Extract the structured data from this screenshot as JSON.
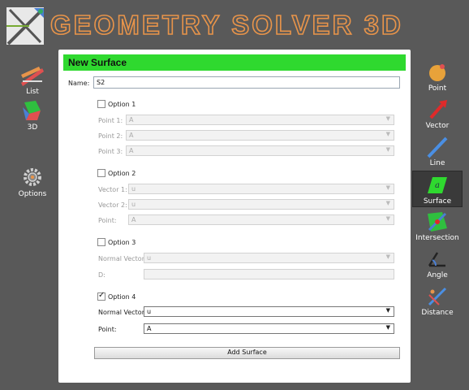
{
  "app": {
    "title": "GEOMETRY SOLVER 3D"
  },
  "left_nav": [
    {
      "label": "List",
      "icon": "list-ruler-icon"
    },
    {
      "label": "3D",
      "icon": "3d-shape-icon"
    },
    {
      "label": "Options",
      "icon": "gear-icon"
    }
  ],
  "right_nav": [
    {
      "label": "Point",
      "icon": "point-icon",
      "active": false
    },
    {
      "label": "Vector",
      "icon": "vector-icon",
      "active": false
    },
    {
      "label": "Line",
      "icon": "line-icon",
      "active": false
    },
    {
      "label": "Surface",
      "icon": "surface-icon",
      "active": true
    },
    {
      "label": "Intersection",
      "icon": "intersection-icon",
      "active": false
    },
    {
      "label": "Angle",
      "icon": "angle-icon",
      "active": false
    },
    {
      "label": "Distance",
      "icon": "distance-icon",
      "active": false
    }
  ],
  "panel": {
    "title": "New Surface",
    "name_label": "Name:",
    "name_value": "S2",
    "option1": {
      "label": "Option 1",
      "checked": false,
      "fields": [
        {
          "label": "Point 1:",
          "value": "A"
        },
        {
          "label": "Point 2:",
          "value": "A"
        },
        {
          "label": "Point 3:",
          "value": "A"
        }
      ]
    },
    "option2": {
      "label": "Option 2",
      "checked": false,
      "fields": [
        {
          "label": "Vector 1:",
          "value": "u"
        },
        {
          "label": "Vector 2:",
          "value": "u"
        },
        {
          "label": "Point:",
          "value": "A"
        }
      ]
    },
    "option3": {
      "label": "Option 3",
      "checked": false,
      "normal_label": "Normal Vector:",
      "normal_value": "u",
      "d_label": "D:",
      "d_value": ""
    },
    "option4": {
      "label": "Option 4",
      "checked": true,
      "normal_label": "Normal Vector:",
      "normal_value": "u",
      "point_label": "Point:",
      "point_value": "A"
    },
    "add_button": "Add Surface"
  },
  "colors": {
    "accent": "#2fd92f",
    "title_stroke": "#e8944a",
    "background": "#595959"
  }
}
